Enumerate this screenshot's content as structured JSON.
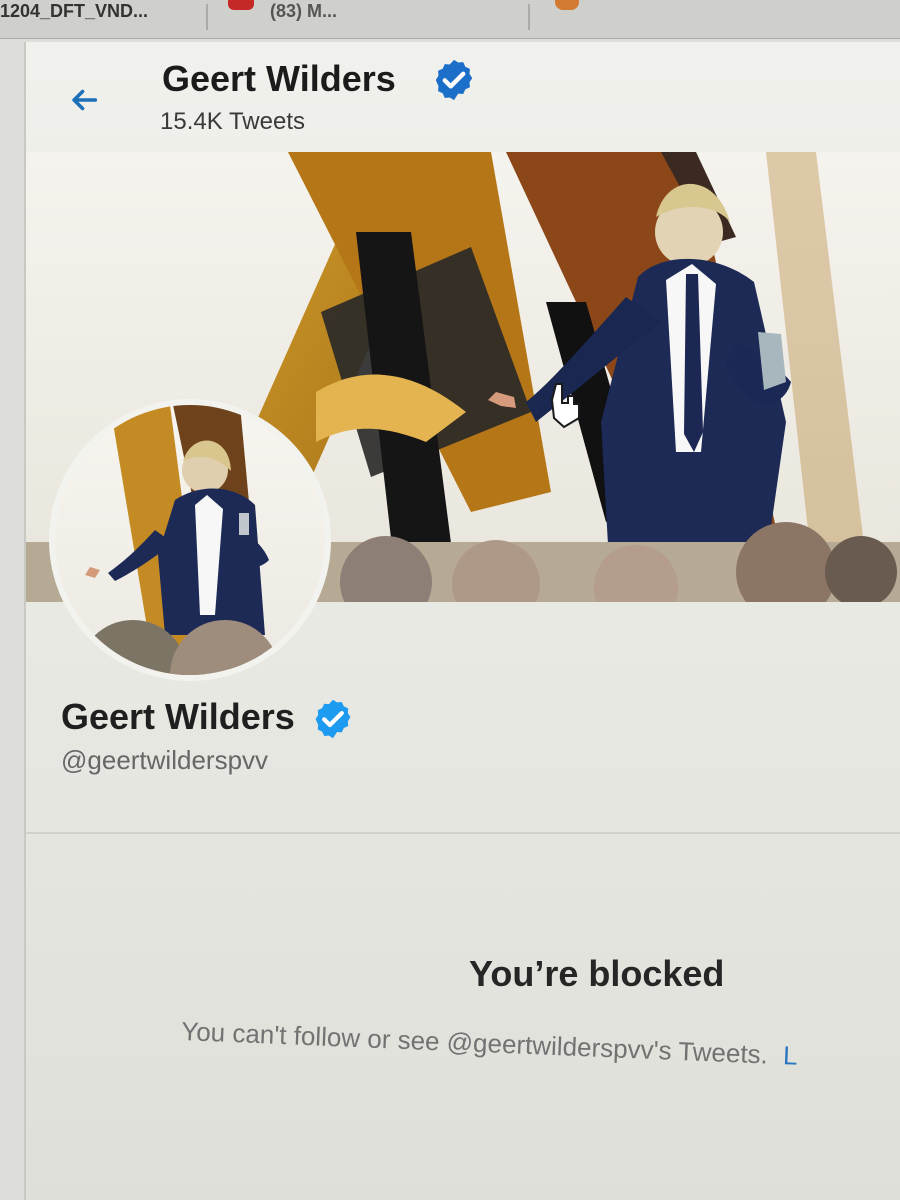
{
  "browser": {
    "tab_title_1": "1204_DFT_VND...",
    "tab_title_2": "(83) M...",
    "tab_icon_red": "red-media-icon",
    "tab_icon_orange": "orange-site-icon"
  },
  "profile_header": {
    "display_name": "Geert Wilders",
    "tweet_count_label": "15.4K Tweets",
    "back_icon": "arrow-left-icon",
    "verified_icon": "verified-badge-icon"
  },
  "profile": {
    "display_name": "Geert Wilders",
    "handle": "@geertwilderspvv",
    "verified_icon": "verified-badge-icon"
  },
  "blocked_notice": {
    "title": "You’re blocked",
    "description": "You can't follow or see @geertwilderspvv's Tweets.",
    "link_text": "L"
  },
  "colors": {
    "accent": "#1d6fb7",
    "verified": "#1d9bf0",
    "page_background": "#f0f0ec"
  }
}
